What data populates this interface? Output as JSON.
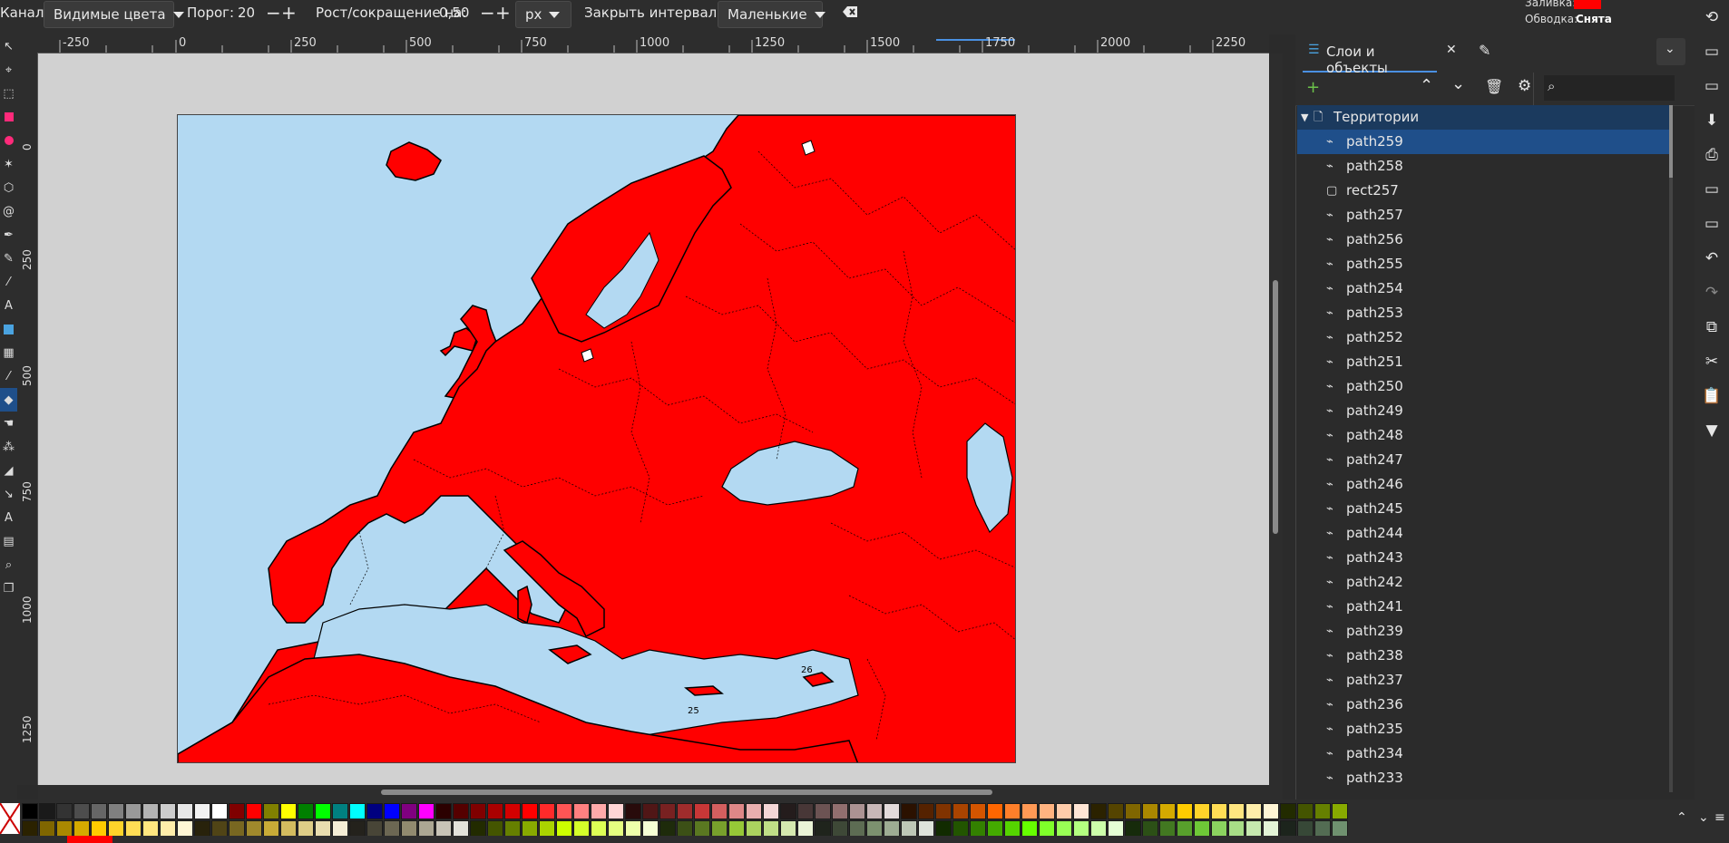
{
  "toolbar": {
    "channel_label": "Канал:",
    "channel_value": "Видимые цвета",
    "threshold_label": "Порог:",
    "threshold_value": "20",
    "grow_label": "Рост/сокращение на:",
    "grow_value": "0,50",
    "unit_value": "px",
    "close_gaps_label": "Закрыть интервалы:",
    "close_gaps_value": "Маленькие"
  },
  "style_indicator": {
    "fill_label": "Заливка:",
    "fill_color": "#ff0000",
    "stroke_label": "Обводка:",
    "stroke_value": "Снята"
  },
  "ruler": {
    "top_ticks": [
      "-250",
      "0",
      "250",
      "500",
      "750",
      "1000",
      "1250",
      "1500",
      "1750",
      "2000",
      "2250"
    ],
    "left_ticks": [
      "0",
      "250",
      "500",
      "750",
      "1000",
      "1250"
    ]
  },
  "map_labels": [
    "25",
    "26"
  ],
  "colors": {
    "land": "#ff0000",
    "sea": "#b3d9f2",
    "canvas_bg": "#d1d1d1",
    "selection": "#1f4f8a"
  },
  "panel": {
    "tab_label": "Слои и объекты",
    "layer_name": "Территории",
    "items": [
      {
        "name": "path259",
        "type": "path",
        "selected": true
      },
      {
        "name": "path258",
        "type": "path"
      },
      {
        "name": "rect257",
        "type": "rect"
      },
      {
        "name": "path257",
        "type": "path"
      },
      {
        "name": "path256",
        "type": "path"
      },
      {
        "name": "path255",
        "type": "path"
      },
      {
        "name": "path254",
        "type": "path"
      },
      {
        "name": "path253",
        "type": "path"
      },
      {
        "name": "path252",
        "type": "path"
      },
      {
        "name": "path251",
        "type": "path"
      },
      {
        "name": "path250",
        "type": "path"
      },
      {
        "name": "path249",
        "type": "path"
      },
      {
        "name": "path248",
        "type": "path"
      },
      {
        "name": "path247",
        "type": "path"
      },
      {
        "name": "path246",
        "type": "path"
      },
      {
        "name": "path245",
        "type": "path"
      },
      {
        "name": "path244",
        "type": "path"
      },
      {
        "name": "path243",
        "type": "path"
      },
      {
        "name": "path242",
        "type": "path"
      },
      {
        "name": "path241",
        "type": "path"
      },
      {
        "name": "path239",
        "type": "path"
      },
      {
        "name": "path238",
        "type": "path"
      },
      {
        "name": "path237",
        "type": "path"
      },
      {
        "name": "path236",
        "type": "path"
      },
      {
        "name": "path235",
        "type": "path"
      },
      {
        "name": "path234",
        "type": "path"
      },
      {
        "name": "path233",
        "type": "path"
      }
    ]
  },
  "palette_row1": [
    "#000000",
    "#1a1a1a",
    "#333333",
    "#4d4d4d",
    "#666666",
    "#808080",
    "#999999",
    "#b3b3b3",
    "#cccccc",
    "#e6e6e6",
    "#f2f2f2",
    "#ffffff",
    "#800000",
    "#ff0000",
    "#808000",
    "#ffff00",
    "#008000",
    "#00ff00",
    "#008080",
    "#00ffff",
    "#000080",
    "#0000ff",
    "#800080",
    "#ff00ff",
    "#2b0000",
    "#550000",
    "#800000",
    "#aa0000",
    "#d40000",
    "#ff0000",
    "#ff2a2a",
    "#ff5555",
    "#ff8080",
    "#ffaaaa",
    "#ffd5d5",
    "#280b0b",
    "#501616",
    "#782121",
    "#a02c2c",
    "#c83737",
    "#d35f5f",
    "#de8787",
    "#e9afaf",
    "#f4d7d7",
    "#241c1c",
    "#483737",
    "#6c5353",
    "#916f6f",
    "#ac9393",
    "#c8b7b7",
    "#e3dbdb",
    "#2b1100",
    "#552200",
    "#803300",
    "#aa4400",
    "#d45500",
    "#ff6600",
    "#ff7f2a",
    "#ff9955",
    "#ffb380",
    "#ffccaa",
    "#ffe6d5",
    "#2b2200",
    "#554400",
    "#806600",
    "#aa8800",
    "#d4aa00",
    "#ffcc00",
    "#ffd42a",
    "#ffdd55",
    "#ffe680",
    "#ffeeaa",
    "#fff6d5",
    "#222b00",
    "#445500",
    "#668000",
    "#88aa00"
  ],
  "palette_row2": [
    "#2b2200",
    "#806600",
    "#aa8800",
    "#d4aa00",
    "#ffcc00",
    "#ffd42a",
    "#ffdd55",
    "#ffe680",
    "#ffeeaa",
    "#fff6d5",
    "#28220b",
    "#504416",
    "#786721",
    "#a0892c",
    "#c8ab37",
    "#d3bc5f",
    "#decd87",
    "#e9ddaf",
    "#f4eed7",
    "#24221c",
    "#484537",
    "#6c6753",
    "#918a6f",
    "#aca793",
    "#c8c4b7",
    "#e3e2db",
    "#222b00",
    "#445500",
    "#668000",
    "#88aa00",
    "#aad400",
    "#ccff00",
    "#d4ff2a",
    "#ddff55",
    "#e5ff80",
    "#eeffaa",
    "#f6ffd5",
    "#1e2b0b",
    "#3c5016",
    "#5a7821",
    "#78a02c",
    "#96c837",
    "#abd35f",
    "#bfde87",
    "#d5e9af",
    "#eaf4d7",
    "#1f241c",
    "#3e4837",
    "#5d6c53",
    "#7c916f",
    "#9dac93",
    "#bec8b7",
    "#dee3db",
    "#112b00",
    "#225500",
    "#338000",
    "#44aa00",
    "#55d400",
    "#66ff00",
    "#7fff2a",
    "#99ff55",
    "#b3ff80",
    "#ccffaa",
    "#e5ffd5",
    "#162b0b",
    "#2c5016",
    "#427821",
    "#58a02c",
    "#6ec837",
    "#8bd35f",
    "#a8de87",
    "#c6e9af",
    "#e3f4d7",
    "#1c241c",
    "#374837",
    "#536c53",
    "#6f916f"
  ]
}
